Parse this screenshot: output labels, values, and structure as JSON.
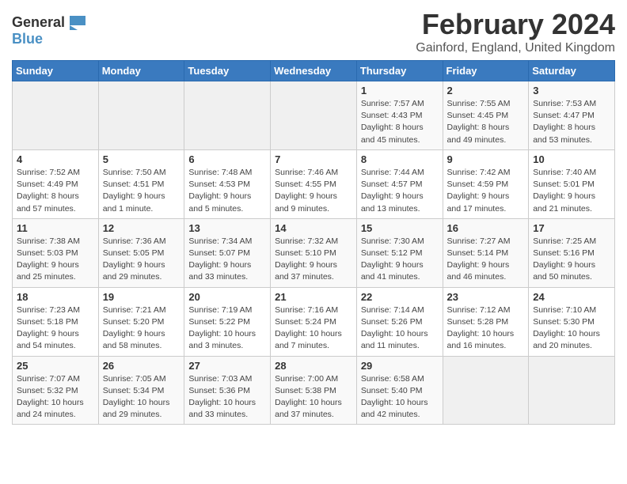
{
  "logo": {
    "general": "General",
    "blue": "Blue"
  },
  "title": "February 2024",
  "location": "Gainford, England, United Kingdom",
  "days_of_week": [
    "Sunday",
    "Monday",
    "Tuesday",
    "Wednesday",
    "Thursday",
    "Friday",
    "Saturday"
  ],
  "weeks": [
    [
      {
        "day": "",
        "info": ""
      },
      {
        "day": "",
        "info": ""
      },
      {
        "day": "",
        "info": ""
      },
      {
        "day": "",
        "info": ""
      },
      {
        "day": "1",
        "info": "Sunrise: 7:57 AM\nSunset: 4:43 PM\nDaylight: 8 hours\nand 45 minutes."
      },
      {
        "day": "2",
        "info": "Sunrise: 7:55 AM\nSunset: 4:45 PM\nDaylight: 8 hours\nand 49 minutes."
      },
      {
        "day": "3",
        "info": "Sunrise: 7:53 AM\nSunset: 4:47 PM\nDaylight: 8 hours\nand 53 minutes."
      }
    ],
    [
      {
        "day": "4",
        "info": "Sunrise: 7:52 AM\nSunset: 4:49 PM\nDaylight: 8 hours\nand 57 minutes."
      },
      {
        "day": "5",
        "info": "Sunrise: 7:50 AM\nSunset: 4:51 PM\nDaylight: 9 hours\nand 1 minute."
      },
      {
        "day": "6",
        "info": "Sunrise: 7:48 AM\nSunset: 4:53 PM\nDaylight: 9 hours\nand 5 minutes."
      },
      {
        "day": "7",
        "info": "Sunrise: 7:46 AM\nSunset: 4:55 PM\nDaylight: 9 hours\nand 9 minutes."
      },
      {
        "day": "8",
        "info": "Sunrise: 7:44 AM\nSunset: 4:57 PM\nDaylight: 9 hours\nand 13 minutes."
      },
      {
        "day": "9",
        "info": "Sunrise: 7:42 AM\nSunset: 4:59 PM\nDaylight: 9 hours\nand 17 minutes."
      },
      {
        "day": "10",
        "info": "Sunrise: 7:40 AM\nSunset: 5:01 PM\nDaylight: 9 hours\nand 21 minutes."
      }
    ],
    [
      {
        "day": "11",
        "info": "Sunrise: 7:38 AM\nSunset: 5:03 PM\nDaylight: 9 hours\nand 25 minutes."
      },
      {
        "day": "12",
        "info": "Sunrise: 7:36 AM\nSunset: 5:05 PM\nDaylight: 9 hours\nand 29 minutes."
      },
      {
        "day": "13",
        "info": "Sunrise: 7:34 AM\nSunset: 5:07 PM\nDaylight: 9 hours\nand 33 minutes."
      },
      {
        "day": "14",
        "info": "Sunrise: 7:32 AM\nSunset: 5:10 PM\nDaylight: 9 hours\nand 37 minutes."
      },
      {
        "day": "15",
        "info": "Sunrise: 7:30 AM\nSunset: 5:12 PM\nDaylight: 9 hours\nand 41 minutes."
      },
      {
        "day": "16",
        "info": "Sunrise: 7:27 AM\nSunset: 5:14 PM\nDaylight: 9 hours\nand 46 minutes."
      },
      {
        "day": "17",
        "info": "Sunrise: 7:25 AM\nSunset: 5:16 PM\nDaylight: 9 hours\nand 50 minutes."
      }
    ],
    [
      {
        "day": "18",
        "info": "Sunrise: 7:23 AM\nSunset: 5:18 PM\nDaylight: 9 hours\nand 54 minutes."
      },
      {
        "day": "19",
        "info": "Sunrise: 7:21 AM\nSunset: 5:20 PM\nDaylight: 9 hours\nand 58 minutes."
      },
      {
        "day": "20",
        "info": "Sunrise: 7:19 AM\nSunset: 5:22 PM\nDaylight: 10 hours\nand 3 minutes."
      },
      {
        "day": "21",
        "info": "Sunrise: 7:16 AM\nSunset: 5:24 PM\nDaylight: 10 hours\nand 7 minutes."
      },
      {
        "day": "22",
        "info": "Sunrise: 7:14 AM\nSunset: 5:26 PM\nDaylight: 10 hours\nand 11 minutes."
      },
      {
        "day": "23",
        "info": "Sunrise: 7:12 AM\nSunset: 5:28 PM\nDaylight: 10 hours\nand 16 minutes."
      },
      {
        "day": "24",
        "info": "Sunrise: 7:10 AM\nSunset: 5:30 PM\nDaylight: 10 hours\nand 20 minutes."
      }
    ],
    [
      {
        "day": "25",
        "info": "Sunrise: 7:07 AM\nSunset: 5:32 PM\nDaylight: 10 hours\nand 24 minutes."
      },
      {
        "day": "26",
        "info": "Sunrise: 7:05 AM\nSunset: 5:34 PM\nDaylight: 10 hours\nand 29 minutes."
      },
      {
        "day": "27",
        "info": "Sunrise: 7:03 AM\nSunset: 5:36 PM\nDaylight: 10 hours\nand 33 minutes."
      },
      {
        "day": "28",
        "info": "Sunrise: 7:00 AM\nSunset: 5:38 PM\nDaylight: 10 hours\nand 37 minutes."
      },
      {
        "day": "29",
        "info": "Sunrise: 6:58 AM\nSunset: 5:40 PM\nDaylight: 10 hours\nand 42 minutes."
      },
      {
        "day": "",
        "info": ""
      },
      {
        "day": "",
        "info": ""
      }
    ]
  ]
}
